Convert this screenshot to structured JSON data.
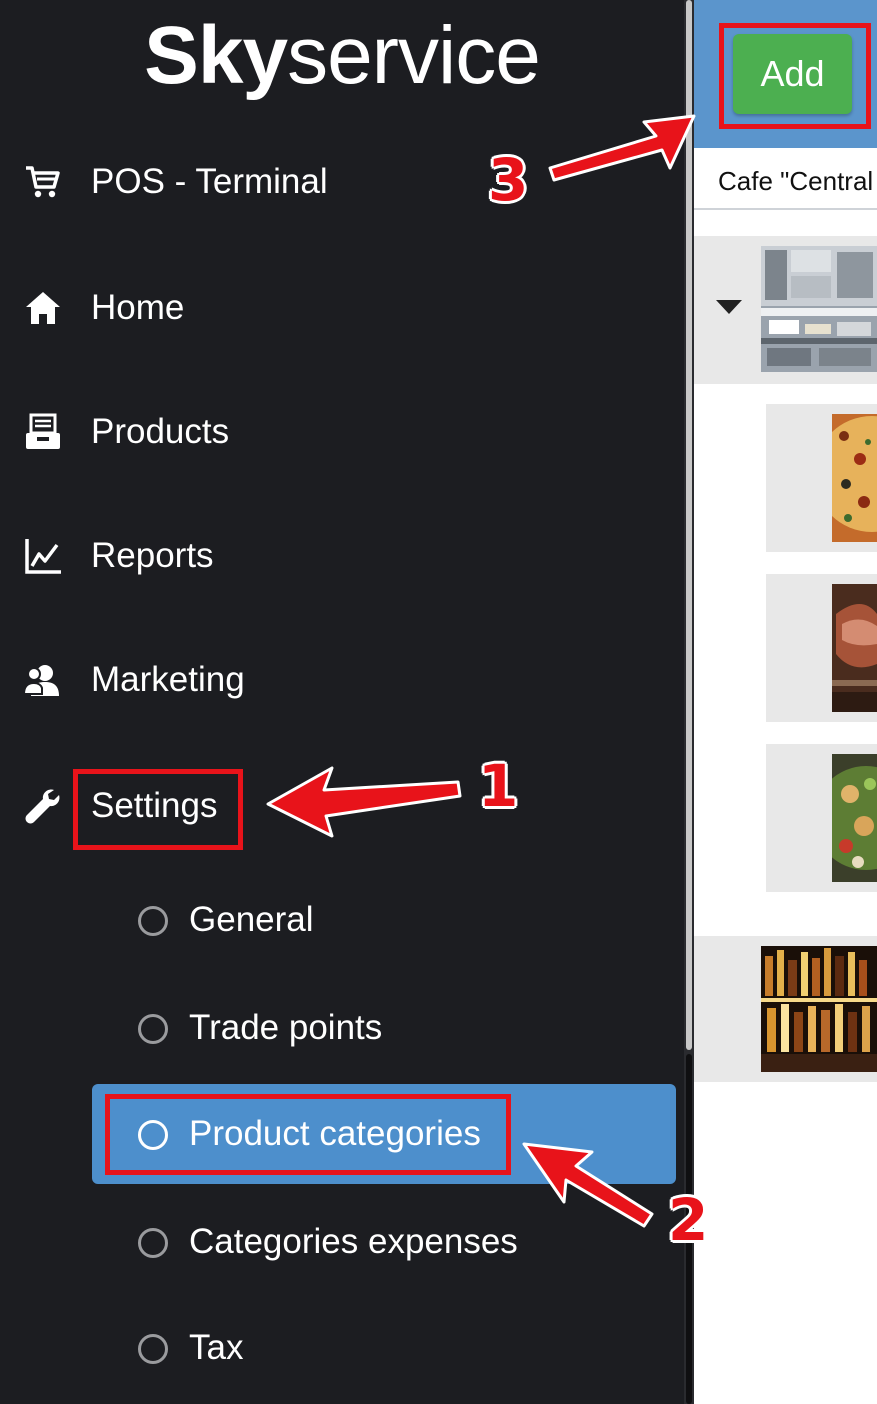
{
  "logo": {
    "bold": "Sky",
    "light": "service"
  },
  "sidebar": {
    "items": [
      {
        "label": "POS - Terminal",
        "icon": "cart-icon"
      },
      {
        "label": "Home",
        "icon": "home-icon"
      },
      {
        "label": "Products",
        "icon": "products-icon"
      },
      {
        "label": "Reports",
        "icon": "chart-icon"
      },
      {
        "label": "Marketing",
        "icon": "users-icon"
      },
      {
        "label": "Settings",
        "icon": "wrench-icon"
      }
    ],
    "settings_sub": [
      {
        "label": "General",
        "active": false
      },
      {
        "label": "Trade points",
        "active": false
      },
      {
        "label": "Product categories",
        "active": true
      },
      {
        "label": "Categories expenses",
        "active": false
      },
      {
        "label": "Tax",
        "active": false
      }
    ]
  },
  "toolbar": {
    "add_label": "Add"
  },
  "trade_point": {
    "value": "Cafe \"Central"
  },
  "annotations": {
    "one": "1",
    "two": "2",
    "three": "3"
  },
  "colors": {
    "sidebar_bg": "#1c1d21",
    "active_item": "#4d8fcc",
    "topbar": "#5b95cc",
    "add_button": "#4caf50",
    "annotation_red": "#e8131a"
  }
}
